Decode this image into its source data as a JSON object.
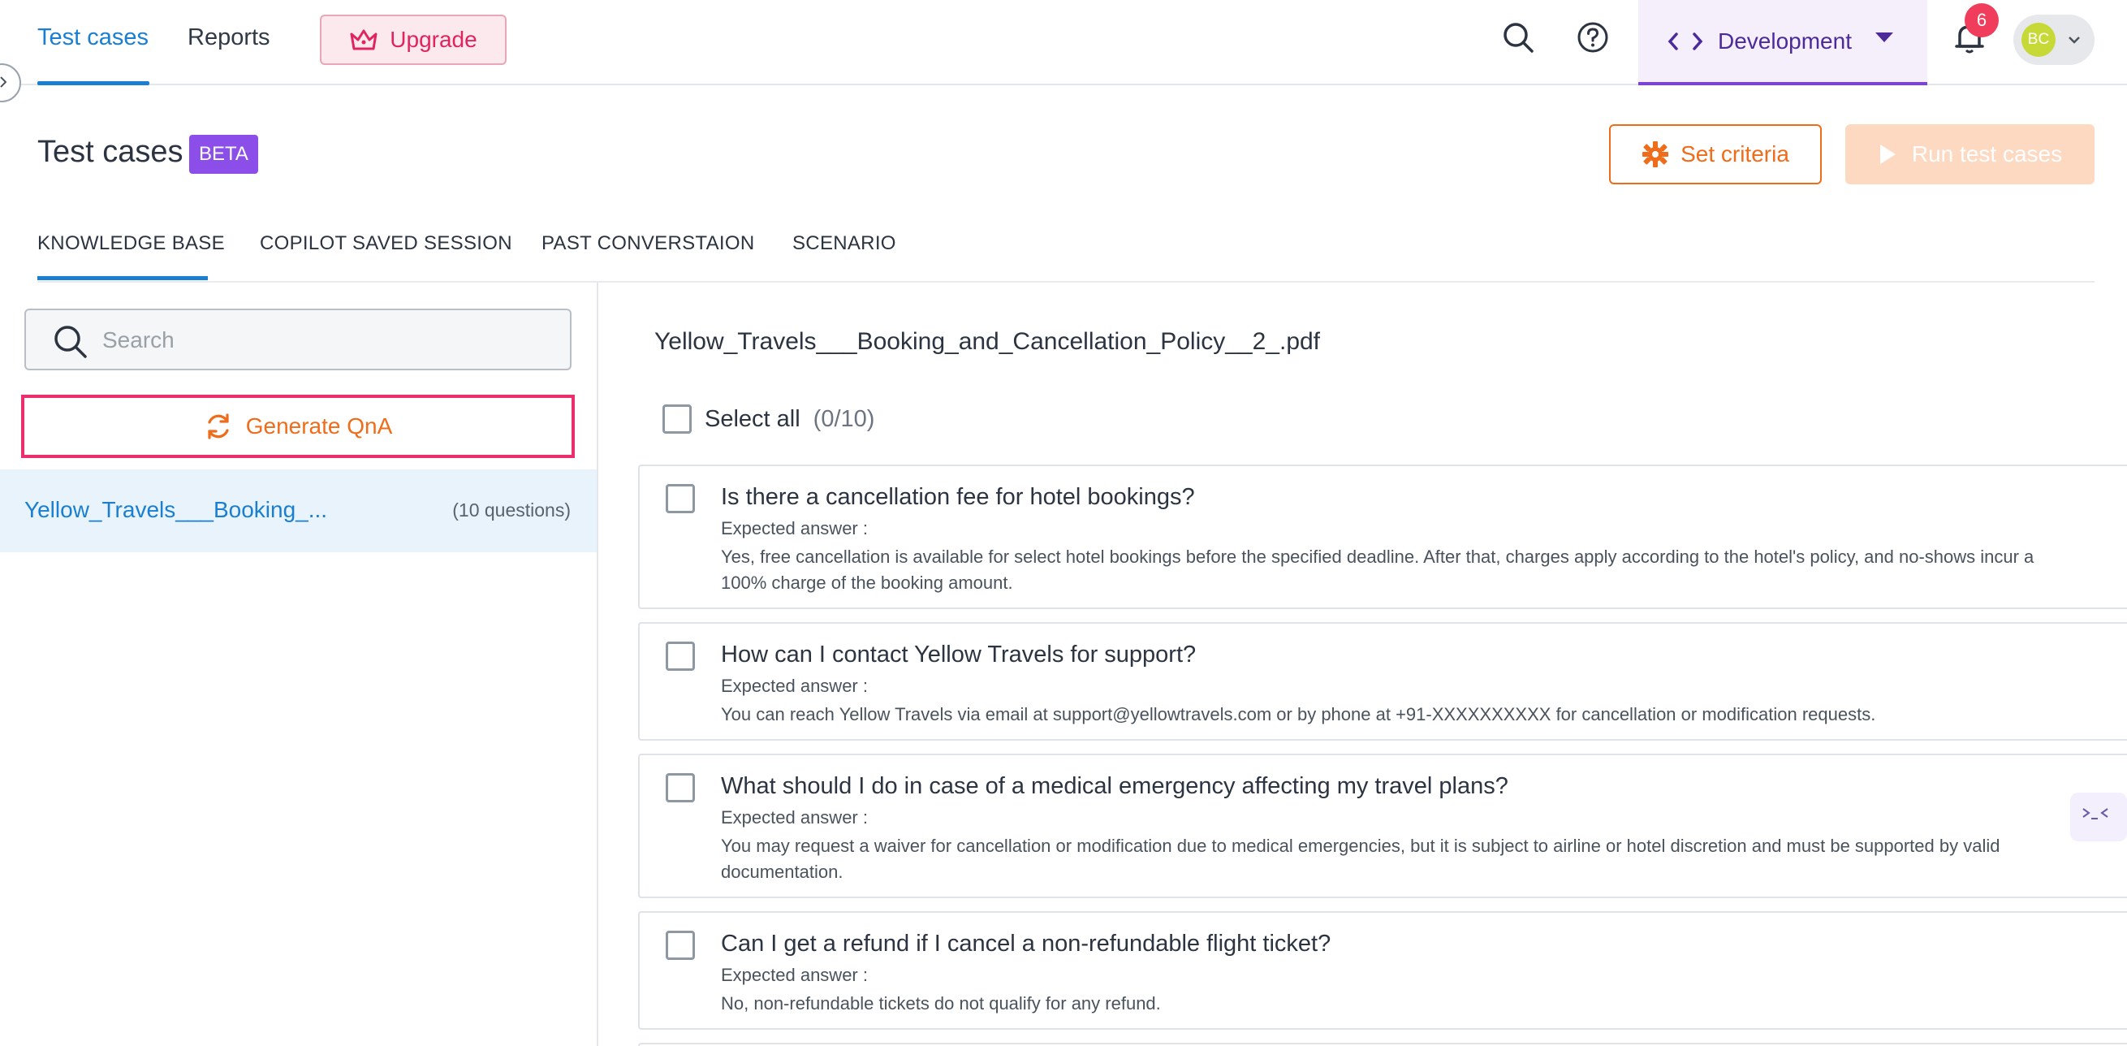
{
  "nav": {
    "tabs": [
      {
        "label": "Test cases"
      },
      {
        "label": "Reports"
      }
    ],
    "upgrade_label": "Upgrade",
    "environment_label": "Development",
    "notification_count": "6",
    "avatar_initials": "BC"
  },
  "header": {
    "title": "Test cases",
    "badge": "BETA",
    "set_criteria_label": "Set criteria",
    "run_label": "Run test cases"
  },
  "subtabs": [
    {
      "label": "KNOWLEDGE BASE"
    },
    {
      "label": "COPILOT SAVED SESSION"
    },
    {
      "label": "PAST CONVERSTAION"
    },
    {
      "label": "SCENARIO"
    }
  ],
  "sidebar": {
    "search_placeholder": "Search",
    "generate_label": "Generate QnA",
    "files": [
      {
        "name": "Yellow_Travels___Booking_...",
        "count": "(10 questions)"
      }
    ]
  },
  "main": {
    "document_title": "Yellow_Travels___Booking_and_Cancellation_Policy__2_.pdf",
    "select_all_label": "Select all",
    "select_all_count": "(0/10)",
    "expected_label": "Expected answer :",
    "questions": [
      {
        "question": "Is there a cancellation fee for hotel bookings?",
        "answer": "Yes, free cancellation is available for select hotel bookings before the specified deadline. After that, charges apply according to the hotel's policy, and no-shows incur a 100% charge of the booking amount."
      },
      {
        "question": "How can I contact Yellow Travels for support?",
        "answer": "You can reach Yellow Travels via email at support@yellowtravels.com or by phone at +91-XXXXXXXXXX for cancellation or modification requests."
      },
      {
        "question": "What should I do in case of a medical emergency affecting my travel plans?",
        "answer": "You may request a waiver for cancellation or modification due to medical emergencies, but it is subject to airline or hotel discretion and must be supported by valid documentation."
      },
      {
        "question": "Can I get a refund if I cancel a non-refundable flight ticket?",
        "answer": "No, non-refundable tickets do not qualify for any refund."
      }
    ]
  },
  "colors": {
    "primary": "#1a7fd1",
    "accent_orange": "#ef6c1a",
    "upgrade_pink": "#e0245e",
    "beta_purple": "#8b4ee8",
    "env_purple": "#4c2a99"
  }
}
